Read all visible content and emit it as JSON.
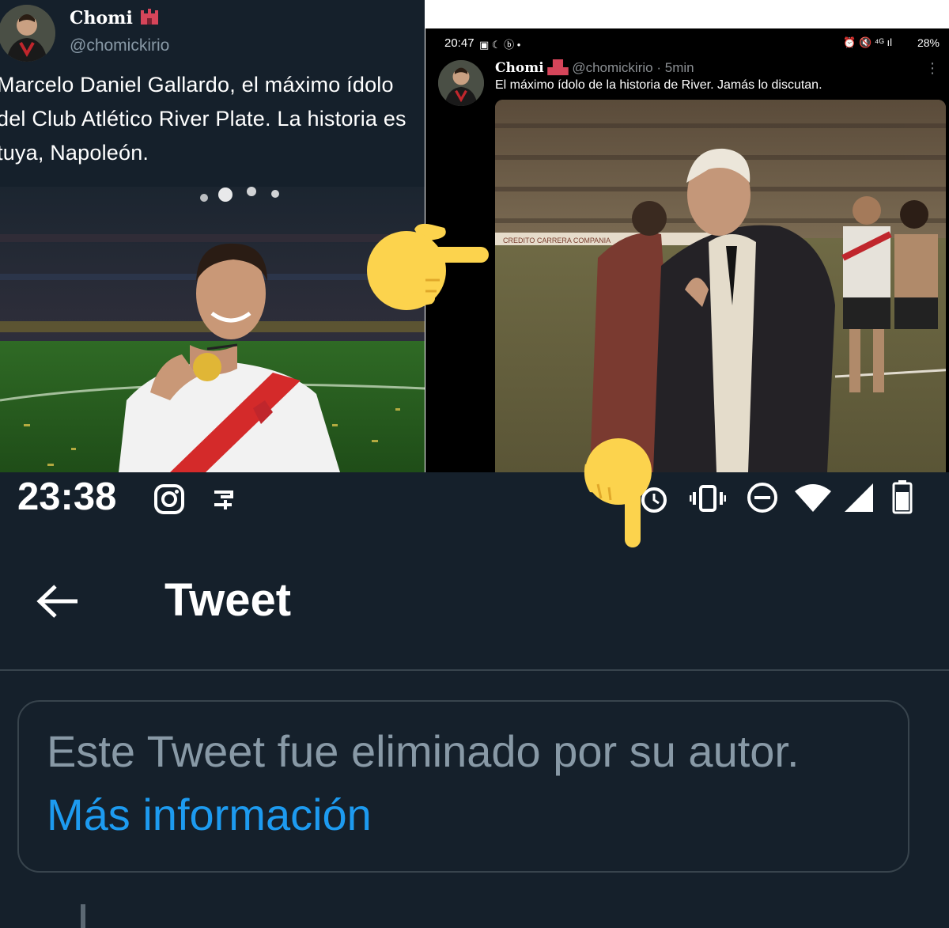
{
  "tweet_original": {
    "display_name": "Chomi",
    "handle": "@chomickirio",
    "text": "Marcelo Daniel Gallardo, el máximo ídolo del Club Atlético River Plate. La historia es tuya, Napoleón."
  },
  "tweet_screenshot": {
    "status_time": "20:47",
    "battery": "28%",
    "display_name": "Chomi",
    "handle": "@chomickirio",
    "separator": "·",
    "age": "5min",
    "text": "El máximo ídolo de la historia de River. Jamás lo discutan.",
    "photo_sign_text": "CREDITO CARRERA COMPANIA"
  },
  "deleted_screen": {
    "status_time": "23:38",
    "title": "Tweet",
    "deleted_message": "Este Tweet fue eliminado por su autor.",
    "more_info_link": "Más información"
  },
  "colors": {
    "twitter_dim_bg": "#15202b",
    "border": "#38444d",
    "muted_text": "#8899a6",
    "link_blue": "#1d9bf0",
    "emoji_yellow": "#fcd34d"
  },
  "icons": [
    "back-arrow-icon",
    "instagram-icon",
    "notification-icon",
    "alarm-icon",
    "vibrate-icon",
    "do-not-disturb-icon",
    "wifi-icon",
    "signal-icon",
    "battery-icon",
    "pointing-right-hand-emoji",
    "pointing-down-hand-emoji"
  ]
}
